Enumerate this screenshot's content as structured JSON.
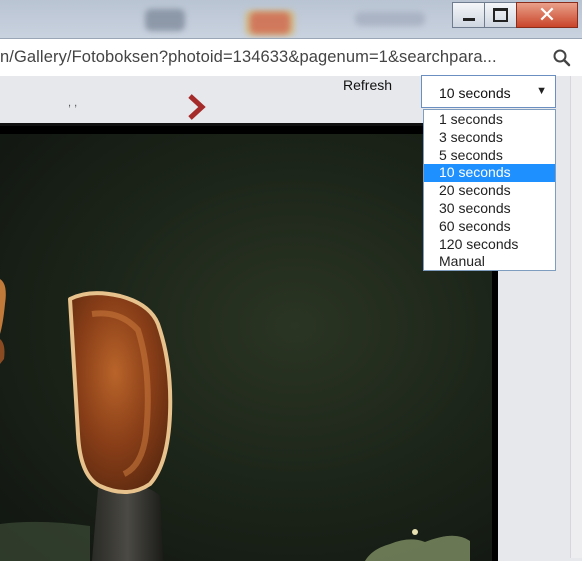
{
  "address_bar": {
    "url": "n/Gallery/Fotoboksen?photoid=134633&pagenum=1&searchpara..."
  },
  "toolbar": {
    "separator_text": ", ,",
    "refresh_label": "Refresh"
  },
  "refresh_select": {
    "selected_value": "10 seconds",
    "options": [
      "1 seconds",
      "3 seconds",
      "5 seconds",
      "10 seconds",
      "20 seconds",
      "30 seconds",
      "60 seconds",
      "120 seconds",
      "Manual"
    ],
    "highlighted_index": 3
  },
  "icons": {
    "minimize": "minimize-icon",
    "maximize": "maximize-icon",
    "close": "close-icon",
    "search": "search-icon",
    "next": "chevron-right-icon",
    "dropdown_arrow": "triangle-down-icon"
  },
  "colors": {
    "highlight": "#1e90ff",
    "next_arrow": "#a52a2a",
    "close_button": "#c9452a"
  }
}
